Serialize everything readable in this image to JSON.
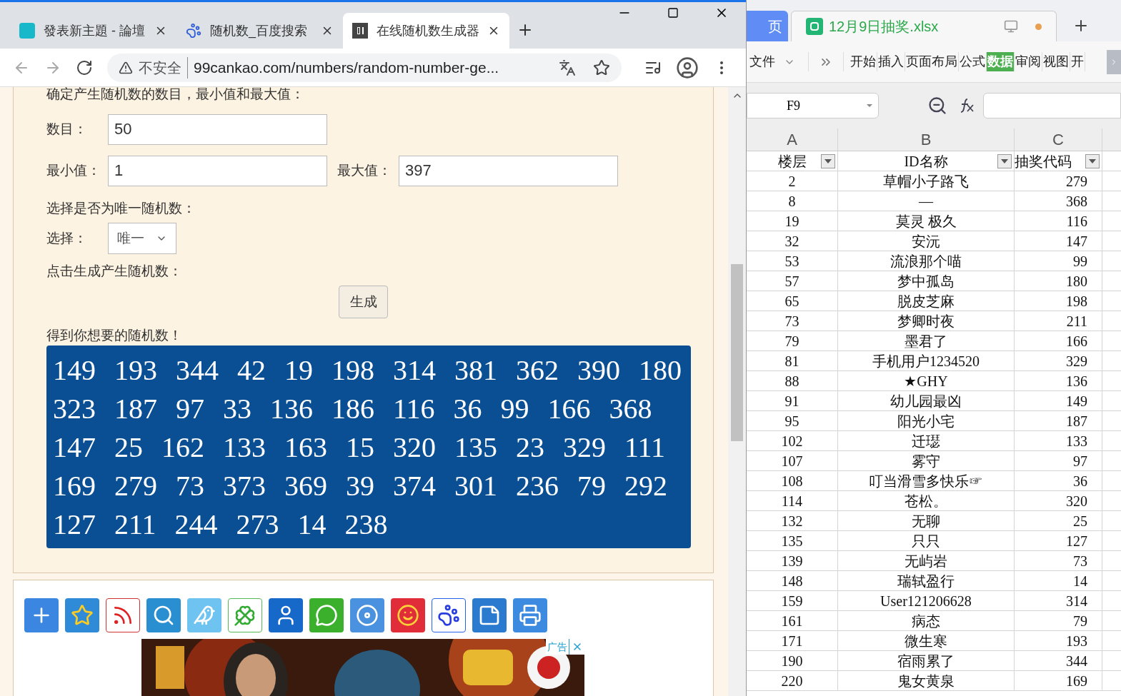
{
  "browser": {
    "tabs": [
      {
        "kind": "tap",
        "title": "發表新主題 - 論壇",
        "selected": false
      },
      {
        "kind": "paw",
        "title": "随机数_百度搜索",
        "selected": false
      },
      {
        "kind": "digits",
        "title": "在线随机数生成器",
        "selected": true
      }
    ],
    "address": {
      "security": "不安全",
      "url": "99cankao.com/numbers/random-number-ge..."
    },
    "form": {
      "intro": "确定产生随机数的数目，最小值和最大值：",
      "count_label": "数目：",
      "count_value": "50",
      "min_label": "最小值：",
      "min_value": "1",
      "max_label": "最大值：",
      "max_value": "397",
      "unique_prompt": "选择是否为唯一随机数：",
      "select_label": "选择：",
      "select_value": "唯一",
      "generate_prompt": "点击生成产生随机数：",
      "generate_button": "生成",
      "result_label": "得到你想要的随机数！",
      "results": [
        "149",
        "193",
        "344",
        "42",
        "19",
        "198",
        "314",
        "381",
        "362",
        "390",
        "180",
        "323",
        "187",
        "97",
        "33",
        "136",
        "186",
        "116",
        "36",
        "99",
        "166",
        "368",
        "147",
        "25",
        "162",
        "133",
        "163",
        "15",
        "320",
        "135",
        "23",
        "329",
        "111",
        "169",
        "279",
        "73",
        "373",
        "369",
        "39",
        "374",
        "301",
        "236",
        "79",
        "292",
        "127",
        "211",
        "244",
        "273",
        "14",
        "238"
      ]
    },
    "share_icons": [
      {
        "kind": "plus"
      },
      {
        "kind": "star"
      },
      {
        "kind": "rss"
      },
      {
        "kind": "search"
      },
      {
        "kind": "bird"
      },
      {
        "kind": "clover"
      },
      {
        "kind": "user"
      },
      {
        "kind": "chat"
      },
      {
        "kind": "disc"
      },
      {
        "kind": "smile"
      },
      {
        "kind": "paw"
      },
      {
        "kind": "note"
      },
      {
        "kind": "printer"
      }
    ],
    "ad": {
      "kind": "picture",
      "label": "广告"
    }
  },
  "sheet": {
    "tabs": [
      {
        "title": "页",
        "selected": false,
        "unsaved": false
      },
      {
        "title": "12月9日抽奖.xlsx",
        "selected": true,
        "unsaved": true
      }
    ],
    "file_menu": "文件",
    "ribbon": [
      {
        "label": "开始",
        "selected": false
      },
      {
        "label": "插入",
        "selected": false
      },
      {
        "label": "页面布局",
        "selected": false
      },
      {
        "label": "公式",
        "selected": false
      },
      {
        "label": "数据",
        "selected": true
      },
      {
        "label": "审阅",
        "selected": false
      },
      {
        "label": "视图",
        "selected": false
      },
      {
        "label": "开",
        "selected": false
      }
    ],
    "name_box": "F9",
    "columns": [
      "A",
      "B",
      "C"
    ],
    "header": [
      "楼层",
      "ID名称",
      "抽奖代码"
    ],
    "rows": [
      [
        "2",
        "草帽小子路飞",
        "279"
      ],
      [
        "8",
        "—",
        "368"
      ],
      [
        "19",
        "莫灵  极久",
        "116"
      ],
      [
        "32",
        "安沅",
        "147"
      ],
      [
        "53",
        "流浪那个喵",
        "99"
      ],
      [
        "57",
        "梦中孤岛",
        "180"
      ],
      [
        "65",
        "脱皮芝麻",
        "198"
      ],
      [
        "73",
        "梦卿时夜",
        "211"
      ],
      [
        "79",
        "墨君了",
        "166"
      ],
      [
        "81",
        "手机用户1234520",
        "329"
      ],
      [
        "88",
        "★GHY",
        "136"
      ],
      [
        "91",
        "幼儿园最凶",
        "149"
      ],
      [
        "95",
        "阳光小宅",
        "187"
      ],
      [
        "102",
        "迁璱",
        "133"
      ],
      [
        "107",
        "雾守",
        "97"
      ],
      [
        "108",
        "叮当滑雪多快乐☞",
        "36"
      ],
      [
        "114",
        "苍松。",
        "320"
      ],
      [
        "132",
        "无聊",
        "25"
      ],
      [
        "135",
        "只只",
        "127"
      ],
      [
        "139",
        "无屿岩",
        "73"
      ],
      [
        "148",
        "瑞轼盈行",
        "14"
      ],
      [
        "159",
        "User121206628",
        "314"
      ],
      [
        "161",
        "病态",
        "79"
      ],
      [
        "171",
        "微生寒",
        "193"
      ],
      [
        "190",
        "宿雨累了",
        "344"
      ],
      [
        "220",
        "鬼女黄泉",
        "169"
      ]
    ]
  }
}
